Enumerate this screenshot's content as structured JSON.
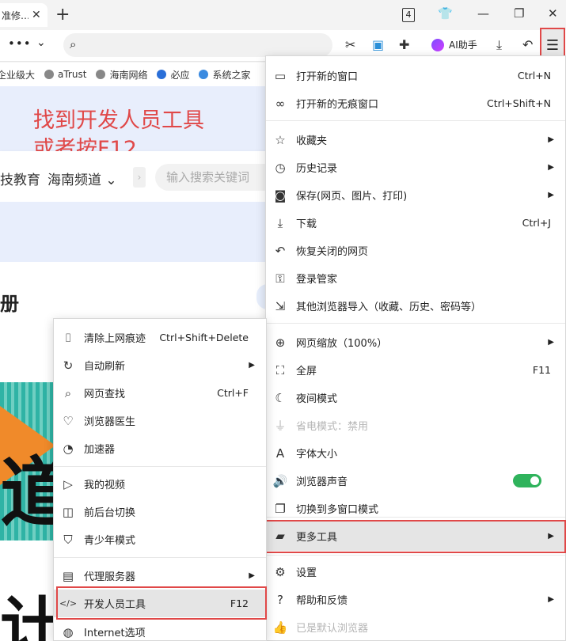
{
  "tab": {
    "title": "准修…",
    "close": "✕",
    "count": "4",
    "new_tab": "+"
  },
  "toolbar": {
    "more": "•••",
    "ai_label": "AI助手"
  },
  "bookmarks": [
    "企业级大",
    "aTrust",
    "海南网络",
    "必应",
    "系统之家"
  ],
  "page": {
    "note": "找到开发人员工具\n或者按F12",
    "nav_items": [
      "技教育",
      "海南频道 ⌄"
    ],
    "search_placeholder": "输入搜索关键词",
    "side_char": "册",
    "banner_glyph": "道",
    "banner_glyph2": "计"
  },
  "main_menu": {
    "items": [
      {
        "label": "打开新的窗口",
        "shortcut": "Ctrl+N",
        "icon": "window-icon"
      },
      {
        "label": "打开新的无痕窗口",
        "shortcut": "Ctrl+Shift+N",
        "icon": "incognito-icon"
      },
      {
        "label": "收藏夹",
        "icon": "star-list-icon",
        "submenu": true
      },
      {
        "label": "历史记录",
        "icon": "clock-icon",
        "submenu": true
      },
      {
        "label": "保存(网页、图片、打印)",
        "icon": "camera-icon",
        "submenu": true
      },
      {
        "label": "下载",
        "shortcut": "Ctrl+J",
        "icon": "download-icon"
      },
      {
        "label": "恢复关闭的网页",
        "icon": "undo-icon"
      },
      {
        "label": "登录管家",
        "icon": "key-icon"
      },
      {
        "label": "其他浏览器导入（收藏、历史、密码等）",
        "icon": "import-icon"
      },
      {
        "label": "网页缩放（100%）",
        "icon": "zoom-icon",
        "submenu": true
      },
      {
        "label": "全屏",
        "shortcut": "F11",
        "icon": "fullscreen-icon"
      },
      {
        "label": "夜间模式",
        "icon": "moon-icon"
      },
      {
        "label": "省电模式：禁用",
        "icon": "plug-icon",
        "disabled": true
      },
      {
        "label": "字体大小",
        "icon": "font-icon"
      },
      {
        "label": "浏览器声音",
        "icon": "speaker-icon",
        "toggle": true
      },
      {
        "label": "切换到多窗口模式",
        "icon": "multi-window-icon"
      },
      {
        "label": "更多工具",
        "icon": "toolbox-icon",
        "submenu": true,
        "highlight": true
      },
      {
        "label": "设置",
        "icon": "gear-icon"
      },
      {
        "label": "帮助和反馈",
        "icon": "help-icon",
        "submenu": true
      },
      {
        "label": "已是默认浏览器",
        "icon": "thumb-icon",
        "disabled": true
      }
    ]
  },
  "sub_menu": {
    "items": [
      {
        "label": "清除上网痕迹",
        "shortcut": "Ctrl+Shift+Delete",
        "icon": "broom-icon"
      },
      {
        "label": "自动刷新",
        "icon": "refresh-icon",
        "submenu": true
      },
      {
        "label": "网页查找",
        "shortcut": "Ctrl+F",
        "icon": "find-icon"
      },
      {
        "label": "浏览器医生",
        "icon": "heart-icon"
      },
      {
        "label": "加速器",
        "icon": "gauge-icon"
      },
      {
        "label": "我的视频",
        "icon": "video-icon"
      },
      {
        "label": "前后台切换",
        "icon": "switch-icon"
      },
      {
        "label": "青少年模式",
        "icon": "shield-icon"
      },
      {
        "label": "代理服务器",
        "icon": "proxy-icon",
        "submenu": true
      },
      {
        "label": "开发人员工具",
        "shortcut": "F12",
        "icon": "code-icon",
        "highlight": true
      },
      {
        "label": "Internet选项",
        "icon": "globe-icon"
      }
    ]
  },
  "colors": {
    "accent_red": "#e04848",
    "toggle_on": "#2fb35c",
    "hover_gray": "#e5e5e5"
  }
}
